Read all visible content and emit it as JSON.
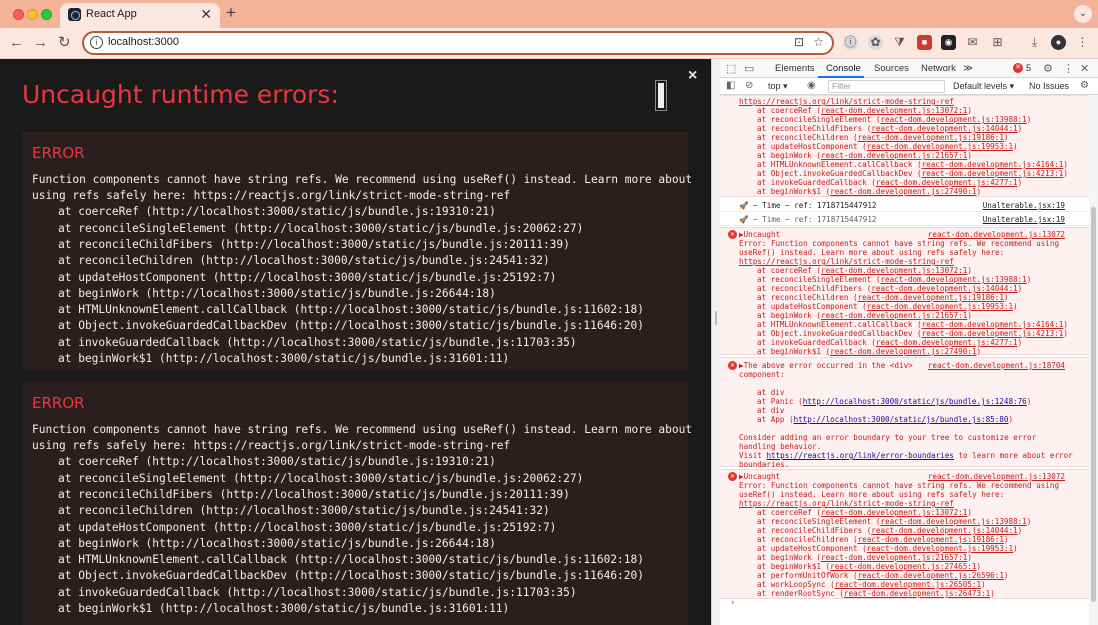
{
  "browser": {
    "tab_title": "React App",
    "tab_close": "✕",
    "new_tab": "+",
    "tab_search": "⌄",
    "back": "←",
    "forward": "→",
    "reload": "↻",
    "info": "i",
    "url": "localhost:3000",
    "install_icon": "⊡",
    "bookmark_icon": "☆",
    "extension_icons": [
      "ⓘ",
      "✿",
      "⧩",
      "■",
      "◉",
      "✉",
      "⊞",
      "⤓",
      "●",
      "⋮"
    ]
  },
  "overlay": {
    "title": "Uncaught runtime errors:",
    "close": "×",
    "errors": [
      {
        "label": "ERROR",
        "message": "Function components cannot have string refs. We recommend using useRef() instead. Learn more about\nusing refs safely here: https://reactjs.org/link/strict-mode-string-ref",
        "frames": [
          "at coerceRef (http://localhost:3000/static/js/bundle.js:19310:21)",
          "at reconcileSingleElement (http://localhost:3000/static/js/bundle.js:20062:27)",
          "at reconcileChildFibers (http://localhost:3000/static/js/bundle.js:20111:39)",
          "at reconcileChildren (http://localhost:3000/static/js/bundle.js:24541:32)",
          "at updateHostComponent (http://localhost:3000/static/js/bundle.js:25192:7)",
          "at beginWork (http://localhost:3000/static/js/bundle.js:26644:18)",
          "at HTMLUnknownElement.callCallback (http://localhost:3000/static/js/bundle.js:11602:18)",
          "at Object.invokeGuardedCallbackDev (http://localhost:3000/static/js/bundle.js:11646:20)",
          "at invokeGuardedCallback (http://localhost:3000/static/js/bundle.js:11703:35)",
          "at beginWork$1 (http://localhost:3000/static/js/bundle.js:31601:11)"
        ]
      },
      {
        "label": "ERROR",
        "message": "Function components cannot have string refs. We recommend using useRef() instead. Learn more about\nusing refs safely here: https://reactjs.org/link/strict-mode-string-ref",
        "frames": [
          "at coerceRef (http://localhost:3000/static/js/bundle.js:19310:21)",
          "at reconcileSingleElement (http://localhost:3000/static/js/bundle.js:20062:27)",
          "at reconcileChildFibers (http://localhost:3000/static/js/bundle.js:20111:39)",
          "at reconcileChildren (http://localhost:3000/static/js/bundle.js:24541:32)",
          "at updateHostComponent (http://localhost:3000/static/js/bundle.js:25192:7)",
          "at beginWork (http://localhost:3000/static/js/bundle.js:26644:18)",
          "at HTMLUnknownElement.callCallback (http://localhost:3000/static/js/bundle.js:11602:18)",
          "at Object.invokeGuardedCallbackDev (http://localhost:3000/static/js/bundle.js:11646:20)",
          "at invokeGuardedCallback (http://localhost:3000/static/js/bundle.js:11703:35)",
          "at beginWork$1 (http://localhost:3000/static/js/bundle.js:31601:11)"
        ]
      }
    ]
  },
  "devtools": {
    "tabs": [
      "Elements",
      "Console",
      "Sources",
      "Network"
    ],
    "more_tabs": "≫",
    "error_count": "5",
    "context": "top ▾",
    "filter_placeholder": "Filter",
    "levels": "Default levels ▾",
    "issues": "No Issues",
    "console": {
      "first_group_link": "https://reactjs.org/link/strict-mode-string-ref",
      "first_group_frames": [
        [
          "at coerceRef (",
          "react-dom.development.js:13072:1",
          ")"
        ],
        [
          "at reconcileSingleElement (",
          "react-dom.development.js:13988:1",
          ")"
        ],
        [
          "at reconcileChildFibers (",
          "react-dom.development.js:14044:1",
          ")"
        ],
        [
          "at reconcileChildren (",
          "react-dom.development.js:19186:1",
          ")"
        ],
        [
          "at updateHostComponent (",
          "react-dom.development.js:19953:1",
          ")"
        ],
        [
          "at beginWork (",
          "react-dom.development.js:21657:1",
          ")"
        ],
        [
          "at HTMLUnknownElement.callCallback (",
          "react-dom.development.js:4164:1",
          ")"
        ],
        [
          "at Object.invokeGuardedCallbackDev (",
          "react-dom.development.js:4213:1",
          ")"
        ],
        [
          "at invokeGuardedCallback (",
          "react-dom.development.js:4277:1",
          ")"
        ],
        [
          "at beginWork$1 (",
          "react-dom.development.js:27490:1",
          ")"
        ]
      ],
      "log1_text": "🚀 ~ Time ~ ref: 1718715447912",
      "log1_src": "Unalterable.jsx:19",
      "log2_text": "🚀 ~ Time ~ ref: 1718715447912",
      "log2_src": "Unalterable.jsx:19",
      "err2_head": "▶Uncaught",
      "err2_src": "react-dom.development.js:13072",
      "err2_msg1": "Error: Function components cannot have string refs. We recommend using",
      "err2_msg2": "useRef() instead. Learn more about using refs safely here:",
      "err2_link": "https://reactjs.org/link/strict-mode-string-ref",
      "err2_frames": [
        [
          "at coerceRef (",
          "react-dom.development.js:13072:1",
          ")"
        ],
        [
          "at reconcileSingleElement (",
          "react-dom.development.js:13988:1",
          ")"
        ],
        [
          "at reconcileChildFibers (",
          "react-dom.development.js:14044:1",
          ")"
        ],
        [
          "at reconcileChildren (",
          "react-dom.development.js:19186:1",
          ")"
        ],
        [
          "at updateHostComponent (",
          "react-dom.development.js:19953:1",
          ")"
        ],
        [
          "at beginWork (",
          "react-dom.development.js:21657:1",
          ")"
        ],
        [
          "at HTMLUnknownElement.callCallback (",
          "react-dom.development.js:4164:1",
          ")"
        ],
        [
          "at Object.invokeGuardedCallbackDev (",
          "react-dom.development.js:4213:1",
          ")"
        ],
        [
          "at invokeGuardedCallback (",
          "react-dom.development.js:4277:1",
          ")"
        ],
        [
          "at beginWork$1 (",
          "react-dom.development.js:27490:1",
          ")"
        ]
      ],
      "err3_head": "▶The above error occurred in the <div>",
      "err3_head2": "component:",
      "err3_src": "react-dom.development.js:18704",
      "err3_lines": [
        [
          "at div",
          "",
          ""
        ],
        [
          "at Panic (",
          "http://localhost:3000/static/js/bundle.js:1248:76",
          ")"
        ],
        [
          "at div",
          "",
          ""
        ],
        [
          "at App (",
          "http://localhost:3000/static/js/bundle.js:85:80",
          ")"
        ]
      ],
      "err3_consider1": "Consider adding an error boundary to your tree to customize error",
      "err3_consider2": "handling behavior.",
      "err3_visit_pre": "Visit ",
      "err3_visit_link": "https://reactjs.org/link/error-boundaries",
      "err3_visit_post": " to learn more about error",
      "err3_visit2": "boundaries.",
      "err4_head": "▶Uncaught",
      "err4_src": "react-dom.development.js:13072",
      "err4_msg1": "Error: Function components cannot have string refs. We recommend using",
      "err4_msg2": "useRef() instead. Learn more about using refs safely here:",
      "err4_link": "https://reactjs.org/link/strict-mode-string-ref",
      "err4_frames": [
        [
          "at coerceRef (",
          "react-dom.development.js:13072:1",
          ")"
        ],
        [
          "at reconcileSingleElement (",
          "react-dom.development.js:13988:1",
          ")"
        ],
        [
          "at reconcileChildFibers (",
          "react-dom.development.js:14044:1",
          ")"
        ],
        [
          "at reconcileChildren (",
          "react-dom.development.js:19186:1",
          ")"
        ],
        [
          "at updateHostComponent (",
          "react-dom.development.js:19953:1",
          ")"
        ],
        [
          "at beginWork (",
          "react-dom.development.js:21657:1",
          ")"
        ],
        [
          "at beginWork$1 (",
          "react-dom.development.js:27465:1",
          ")"
        ],
        [
          "at performUnitOfWork (",
          "react-dom.development.js:26596:1",
          ")"
        ],
        [
          "at workLoopSync (",
          "react-dom.development.js:26505:1",
          ")"
        ],
        [
          "at renderRootSync (",
          "react-dom.development.js:26473:1",
          ")"
        ]
      ],
      "prompt": "›"
    }
  }
}
